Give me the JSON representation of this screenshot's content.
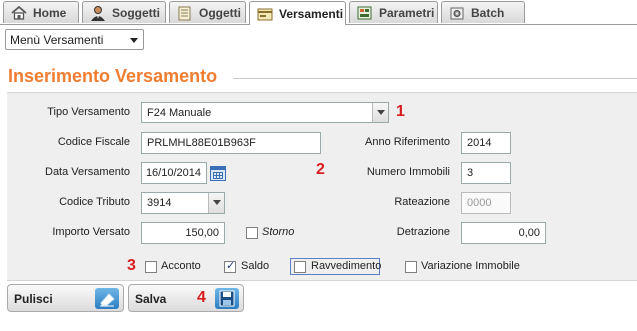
{
  "tabs": [
    {
      "label": "Home",
      "icon": "home-icon",
      "active": false
    },
    {
      "label": "Soggetti",
      "icon": "user-icon",
      "active": false
    },
    {
      "label": "Oggetti",
      "icon": "document-icon",
      "active": false
    },
    {
      "label": "Versamenti",
      "icon": "payment-icon",
      "active": true
    },
    {
      "label": "Parametri",
      "icon": "settings-icon",
      "active": false
    },
    {
      "label": "Batch",
      "icon": "batch-icon",
      "active": false
    }
  ],
  "menu": {
    "selected": "Menù Versamenti"
  },
  "section_title": "Inserimento Versamento",
  "form": {
    "tipo_versamento": {
      "label": "Tipo Versamento",
      "value": "F24 Manuale"
    },
    "codice_fiscale": {
      "label": "Codice Fiscale",
      "value": "PRLMHL88E01B963F"
    },
    "anno_riferimento": {
      "label": "Anno Riferimento",
      "value": "2014"
    },
    "data_versamento": {
      "label": "Data Versamento",
      "value": "16/10/2014"
    },
    "numero_immobili": {
      "label": "Numero Immobili",
      "value": "3"
    },
    "codice_tributo": {
      "label": "Codice Tributo",
      "value": "3914"
    },
    "rateazione": {
      "label": "Rateazione",
      "placeholder": "0000"
    },
    "importo_versato": {
      "label": "Importo Versato",
      "value": "150,00"
    },
    "storno": {
      "label": "Storno",
      "checked": false
    },
    "detrazione": {
      "label": "Detrazione",
      "value": "0,00"
    },
    "checkboxes": [
      {
        "label": "Acconto",
        "checked": false
      },
      {
        "label": "Saldo",
        "checked": true
      },
      {
        "label": "Ravvedimento",
        "checked": false
      },
      {
        "label": "Variazione Immobile",
        "checked": false
      }
    ]
  },
  "markers": [
    "1",
    "2",
    "3",
    "4"
  ],
  "buttons": {
    "pulisci": "Pulisci",
    "salva": "Salva"
  },
  "colors": {
    "title": "#f07d30",
    "marker": "#d81e1e",
    "panel": "#efefef"
  }
}
